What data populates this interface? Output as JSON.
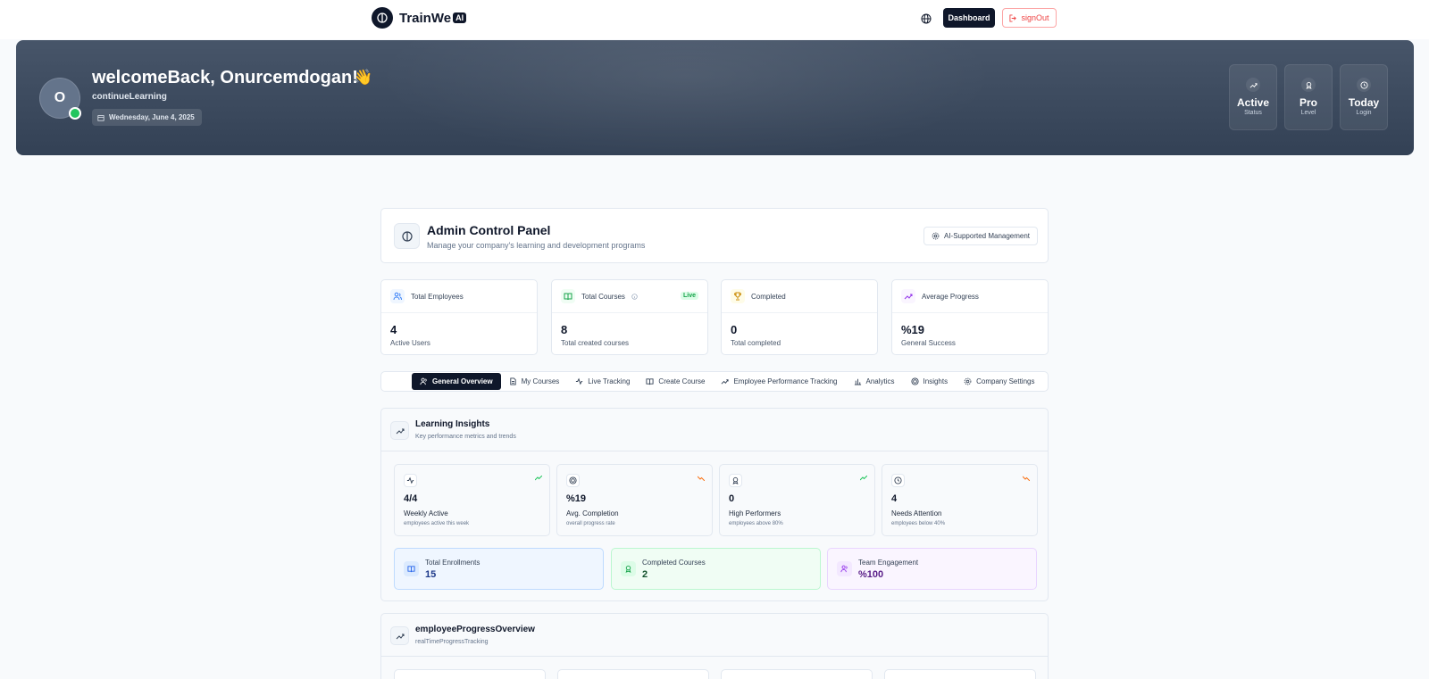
{
  "nav": {
    "logo_text": "TrainWe",
    "logo_badge": "AI",
    "dashboard_label": "Dashboard",
    "signout_label": "signOut"
  },
  "hero": {
    "avatar_initial": "O",
    "title": "welcomeBack, Onurcemdogan!",
    "wave": "👋",
    "subtitle": "continueLearning",
    "date": "Wednesday, June 4, 2025",
    "stats": [
      {
        "value": "Active",
        "label": "Status",
        "icon": "trending-up-icon"
      },
      {
        "value": "Pro",
        "label": "Level",
        "icon": "award-icon"
      },
      {
        "value": "Today",
        "label": "Login",
        "icon": "clock-icon"
      }
    ]
  },
  "admin": {
    "title": "Admin Control Panel",
    "subtitle": "Manage your company's learning and development programs",
    "chip": "AI-Supported Management"
  },
  "metrics": [
    {
      "title": "Total Employees",
      "value": "4",
      "sub": "Active Users",
      "icon": "users-icon",
      "color": "#3b82f6"
    },
    {
      "title": "Total Courses",
      "value": "8",
      "sub": "Total created courses",
      "icon": "book-icon",
      "color": "#16a34a",
      "badge": "Live"
    },
    {
      "title": "Completed",
      "value": "0",
      "sub": "Total completed",
      "icon": "trophy-icon",
      "color": "#ca8a04"
    },
    {
      "title": "Average Progress",
      "value": "%19",
      "sub": "General Success",
      "icon": "trending-up-icon",
      "color": "#9333ea"
    }
  ],
  "tabs": [
    {
      "label": "General Overview",
      "icon": "users-icon",
      "active": true
    },
    {
      "label": "My Courses",
      "icon": "file-icon"
    },
    {
      "label": "Live Tracking",
      "icon": "activity-icon"
    },
    {
      "label": "Create Course",
      "icon": "book-icon"
    },
    {
      "label": "Employee Performance Tracking",
      "icon": "trending-up-icon"
    },
    {
      "label": "Analytics",
      "icon": "bar-chart-icon"
    },
    {
      "label": "Insights",
      "icon": "target-icon"
    },
    {
      "label": "Company Settings",
      "icon": "gear-icon"
    }
  ],
  "insights": {
    "title": "Learning Insights",
    "subtitle": "Key performance metrics and trends",
    "cards": [
      {
        "value": "4/4",
        "label": "Weekly Active",
        "sub": "employees active this week",
        "icon": "activity-icon",
        "trend": "up"
      },
      {
        "value": "%19",
        "label": "Avg. Completion",
        "sub": "overall progress rate",
        "icon": "target-icon",
        "trend": "down"
      },
      {
        "value": "0",
        "label": "High Performers",
        "sub": "employees above 80%",
        "icon": "award-icon",
        "trend": "up"
      },
      {
        "value": "4",
        "label": "Needs Attention",
        "sub": "employees below 40%",
        "icon": "clock-icon",
        "trend": "down"
      }
    ],
    "summary": [
      {
        "label": "Total Enrollments",
        "value": "15",
        "icon": "book-icon",
        "bg": "#eff6ff",
        "border": "#bfdbfe",
        "accent": "#1e3a8a"
      },
      {
        "label": "Completed Courses",
        "value": "2",
        "icon": "award-icon",
        "bg": "#f0fdf4",
        "border": "#bbf7d0",
        "accent": "#14532d"
      },
      {
        "label": "Team Engagement",
        "value": "%100",
        "icon": "users-icon",
        "bg": "#faf5ff",
        "border": "#e9d5ff",
        "accent": "#581c87"
      }
    ]
  },
  "progress": {
    "title": "employeeProgressOverview",
    "subtitle": "realTimeProgressTracking"
  }
}
